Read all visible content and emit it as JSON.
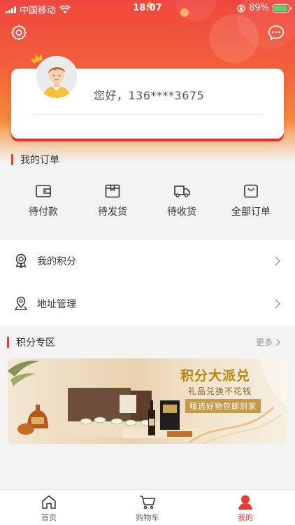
{
  "status_bar": {
    "carrier": "中国移动",
    "time": "18:07",
    "battery": "89%",
    "battery_level": 0.89
  },
  "profile": {
    "greeting": "您好，136****3675"
  },
  "orders": {
    "title": "我的订单",
    "items": [
      {
        "label": "待付款",
        "icon": "wallet-icon"
      },
      {
        "label": "待发货",
        "icon": "package-icon"
      },
      {
        "label": "待收货",
        "icon": "truck-icon"
      },
      {
        "label": "全部订单",
        "icon": "bag-icon"
      }
    ]
  },
  "menu": [
    {
      "label": "我的积分",
      "icon": "medal-icon"
    },
    {
      "label": "地址管理",
      "icon": "location-icon"
    }
  ],
  "points_zone": {
    "title": "积分专区",
    "more": "更多",
    "banner": {
      "headline": "积分大派兑",
      "subline": "礼品兑换不花钱",
      "tag": "精选好物包邮到家"
    }
  },
  "tabbar": [
    {
      "label": "首页",
      "icon": "home-icon"
    },
    {
      "label": "购物车",
      "icon": "cart-icon"
    },
    {
      "label": "我的",
      "icon": "user-icon",
      "active": true
    }
  ],
  "colors": {
    "accent": "#e83a30",
    "header_top": "#f0463f",
    "header_bottom": "#f6a046"
  }
}
